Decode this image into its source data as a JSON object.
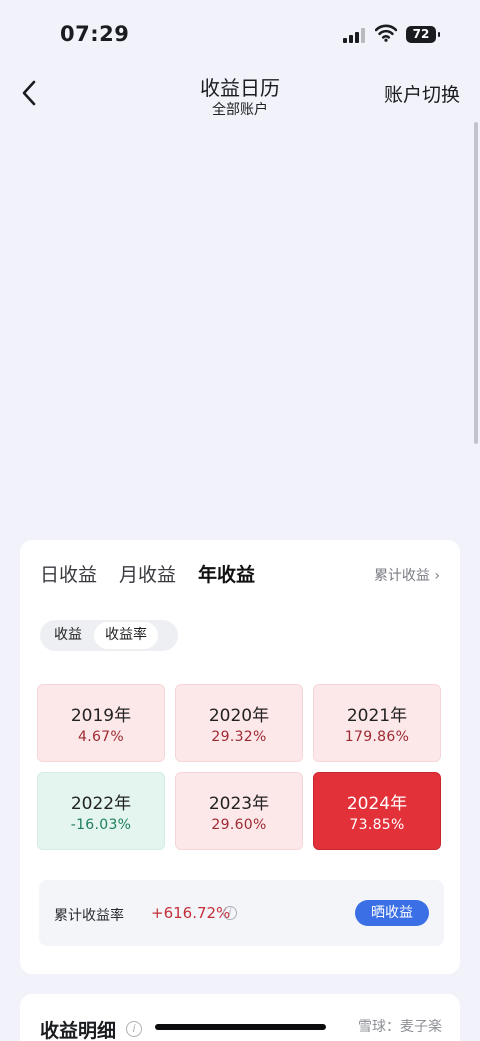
{
  "status_bar": {
    "time": "07:29",
    "battery": "72"
  },
  "header": {
    "title": "收益日历",
    "subtitle": "全部账户",
    "switch_label": "账户切换"
  },
  "tabs": [
    {
      "label": "日收益",
      "active": false
    },
    {
      "label": "月收益",
      "active": false
    },
    {
      "label": "年收益",
      "active": true
    }
  ],
  "cumulative_link": "累计收益 ›",
  "segment": {
    "option_amount": "收益",
    "option_rate": "收益率",
    "selected": "收益率"
  },
  "years": [
    {
      "year": "2019年",
      "value": "4.67%",
      "tone": "pos"
    },
    {
      "year": "2020年",
      "value": "29.32%",
      "tone": "pos"
    },
    {
      "year": "2021年",
      "value": "179.86%",
      "tone": "pos"
    },
    {
      "year": "2022年",
      "value": "-16.03%",
      "tone": "neg"
    },
    {
      "year": "2023年",
      "value": "29.60%",
      "tone": "pos"
    },
    {
      "year": "2024年",
      "value": "73.85%",
      "tone": "sel"
    }
  ],
  "summary": {
    "label": "累计收益率",
    "value": "+616.72%",
    "share_button": "晒收益"
  },
  "detail": {
    "title": "收益明细",
    "watermark": "雪球：麦子楽"
  },
  "colors": {
    "positive": "#9e2a32",
    "negative": "#1d7f5a",
    "selected": "#e3313a",
    "accent": "#3a6fe6"
  }
}
